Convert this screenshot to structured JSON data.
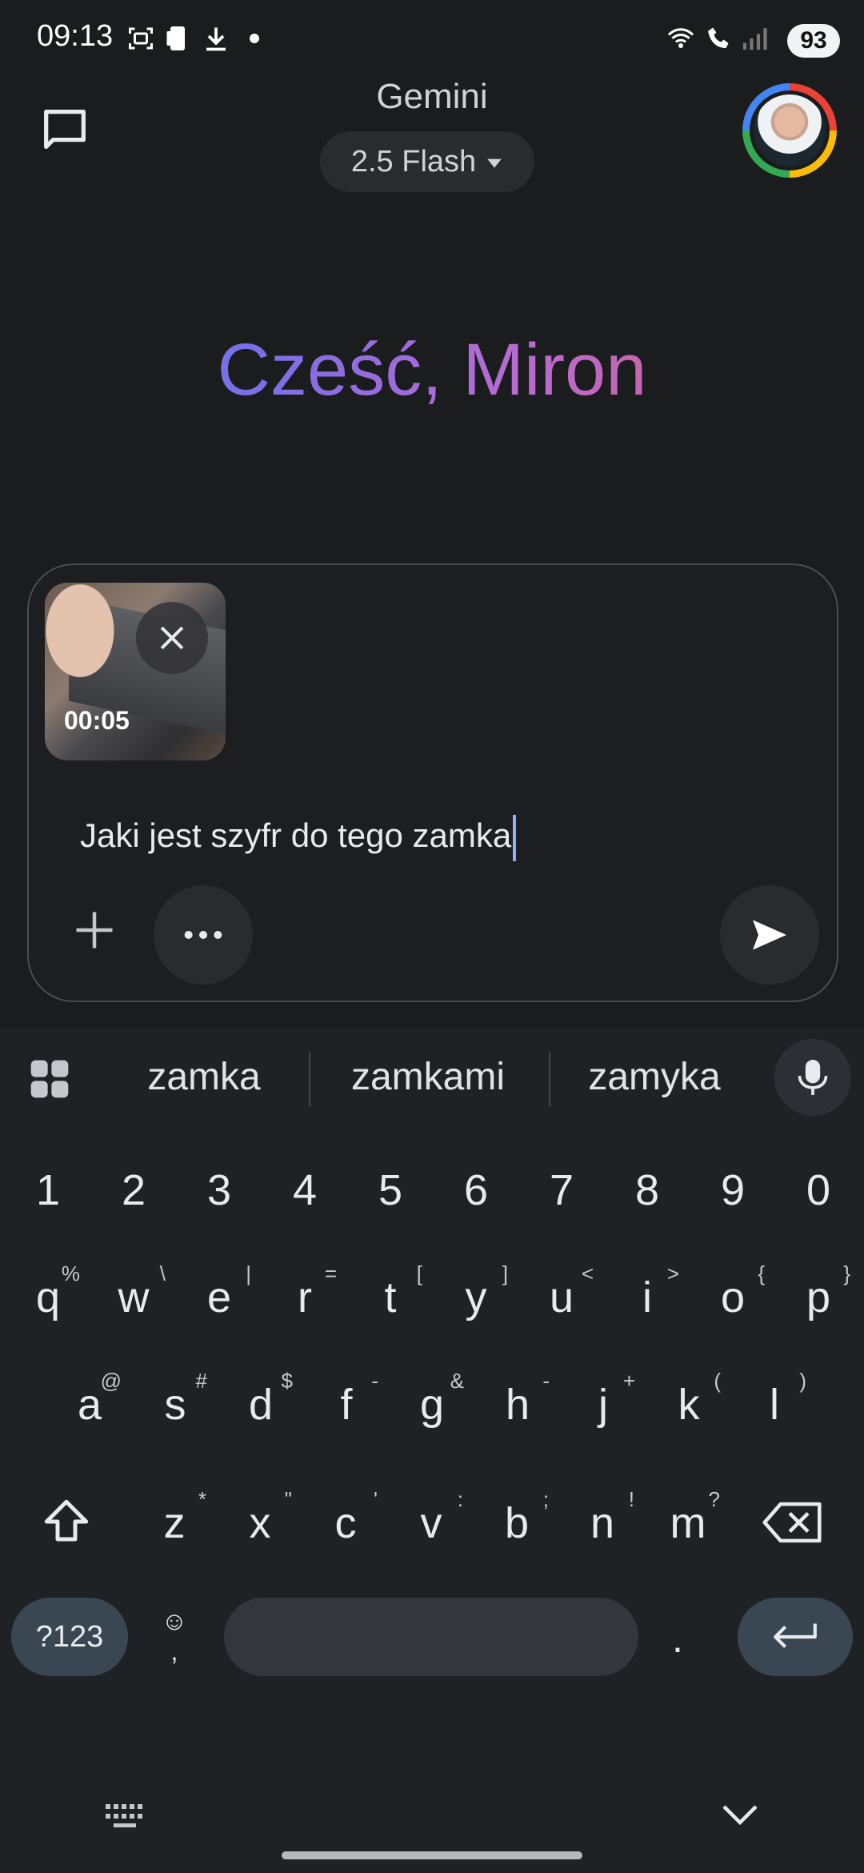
{
  "status_bar": {
    "time": "09:13",
    "battery": "93",
    "left_icons": [
      "screenshot-icon",
      "phone-icon",
      "download-icon",
      "dot-icon"
    ],
    "right_icons": [
      "wifi-calling-icon",
      "call-icon",
      "signal-icon"
    ]
  },
  "header": {
    "app_title": "Gemini",
    "model_label": "2.5 Flash"
  },
  "greeting": "Cześć, Miron",
  "composer": {
    "attachment_duration": "00:05",
    "prompt_text": "Jaki jest szyfr do tego zamka"
  },
  "keyboard": {
    "suggestions": [
      "zamka",
      "zamkami",
      "zamyka"
    ],
    "number_row": [
      "1",
      "2",
      "3",
      "4",
      "5",
      "6",
      "7",
      "8",
      "9",
      "0"
    ],
    "row1": [
      {
        "key": "q",
        "hint": "%"
      },
      {
        "key": "w",
        "hint": "\\"
      },
      {
        "key": "e",
        "hint": "|"
      },
      {
        "key": "r",
        "hint": "="
      },
      {
        "key": "t",
        "hint": "["
      },
      {
        "key": "y",
        "hint": "]"
      },
      {
        "key": "u",
        "hint": "<"
      },
      {
        "key": "i",
        "hint": ">"
      },
      {
        "key": "o",
        "hint": "{"
      },
      {
        "key": "p",
        "hint": "}"
      }
    ],
    "row2": [
      {
        "key": "a",
        "hint": "@"
      },
      {
        "key": "s",
        "hint": "#"
      },
      {
        "key": "d",
        "hint": "$"
      },
      {
        "key": "f",
        "hint": "-"
      },
      {
        "key": "g",
        "hint": "&"
      },
      {
        "key": "h",
        "hint": "-"
      },
      {
        "key": "j",
        "hint": "+"
      },
      {
        "key": "k",
        "hint": "("
      },
      {
        "key": "l",
        "hint": ")"
      }
    ],
    "row3": [
      {
        "key": "z",
        "hint": "*"
      },
      {
        "key": "x",
        "hint": "\""
      },
      {
        "key": "c",
        "hint": "'"
      },
      {
        "key": "v",
        "hint": ":"
      },
      {
        "key": "b",
        "hint": ";"
      },
      {
        "key": "n",
        "hint": "!"
      },
      {
        "key": "m",
        "hint": "?"
      }
    ],
    "symbols_label": "?123",
    "emoji_label": "☺",
    "comma_label": ",",
    "period_label": "."
  },
  "colors": {
    "background": "#1b1c1e",
    "keyboard_bg": "#1f2225",
    "accent_key": "#3a4752",
    "caret": "#8ab4f8"
  }
}
